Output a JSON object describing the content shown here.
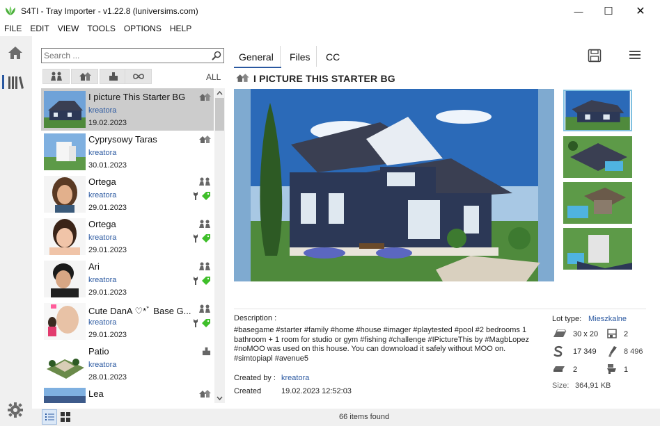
{
  "window": {
    "title": "S4TI - Tray Importer - v1.22.8  (luniversims.com)",
    "minimize_symbol": "—",
    "maximize_symbol": "☐",
    "close_symbol": "✕"
  },
  "menu": [
    "FILE",
    "EDIT",
    "VIEW",
    "TOOLS",
    "OPTIONS",
    "HELP"
  ],
  "search": {
    "placeholder": "Search ...",
    "value": ""
  },
  "filters": {
    "all_label": "ALL"
  },
  "items": [
    {
      "name": "I picture This Starter BG",
      "author": "kreatora",
      "date": "19.02.2023",
      "type": "lot"
    },
    {
      "name": "Cyprysowy Taras",
      "author": "kreatora",
      "date": "30.01.2023",
      "type": "lot"
    },
    {
      "name": "Ortega",
      "author": "kreatora",
      "date": "29.01.2023",
      "type": "household"
    },
    {
      "name": "Ortega",
      "author": "kreatora",
      "date": "29.01.2023",
      "type": "household"
    },
    {
      "name": "Ari",
      "author": "kreatora",
      "date": "29.01.2023",
      "type": "household"
    },
    {
      "name": "Cute  DanA ♡*ﾞ Base G...",
      "author": "kreatora",
      "date": "29.01.2023",
      "type": "household"
    },
    {
      "name": "Patio",
      "author": "kreatora",
      "date": "28.01.2023",
      "type": "room"
    },
    {
      "name": "Lea",
      "author": "",
      "date": "",
      "type": "lot"
    }
  ],
  "status": {
    "count": "66 items found"
  },
  "tabs": {
    "general": "General",
    "files": "Files",
    "cc": "CC"
  },
  "detail": {
    "title": "I PICTURE THIS STARTER BG",
    "description_label": "Description :",
    "description": "#basegame #starter #family #home #house #imager #playtested #pool #2 bedrooms 1 bathroom + 1 room for studio  or gym #fishing #challenge #IPictureThis  by #MagbLopez #noMOO was used on this house. You can downoload it safely without MOO on. #simtopiapl #avenue5",
    "created_by_label": "Created by :",
    "created_by": "kreatora",
    "created_label": "Created",
    "created_colon": ":",
    "created": "19.02.2023 12:52:03",
    "lot_type_label": "Lot type:",
    "lot_type": "Mieszkalne",
    "size_lot": "30 x 20",
    "floors": "2",
    "price": "17 349",
    "objects": "8 496",
    "bedrooms": "2",
    "bathrooms": "1",
    "file_size_label": "Size:",
    "file_size": "364,91 KB"
  },
  "colors": {
    "accent": "#2a58a0",
    "selected_row": "#cccccc",
    "panel_bg": "#f0f0f0",
    "logo_green": "#4caf3c",
    "cc_green": "#3fbf2a"
  }
}
